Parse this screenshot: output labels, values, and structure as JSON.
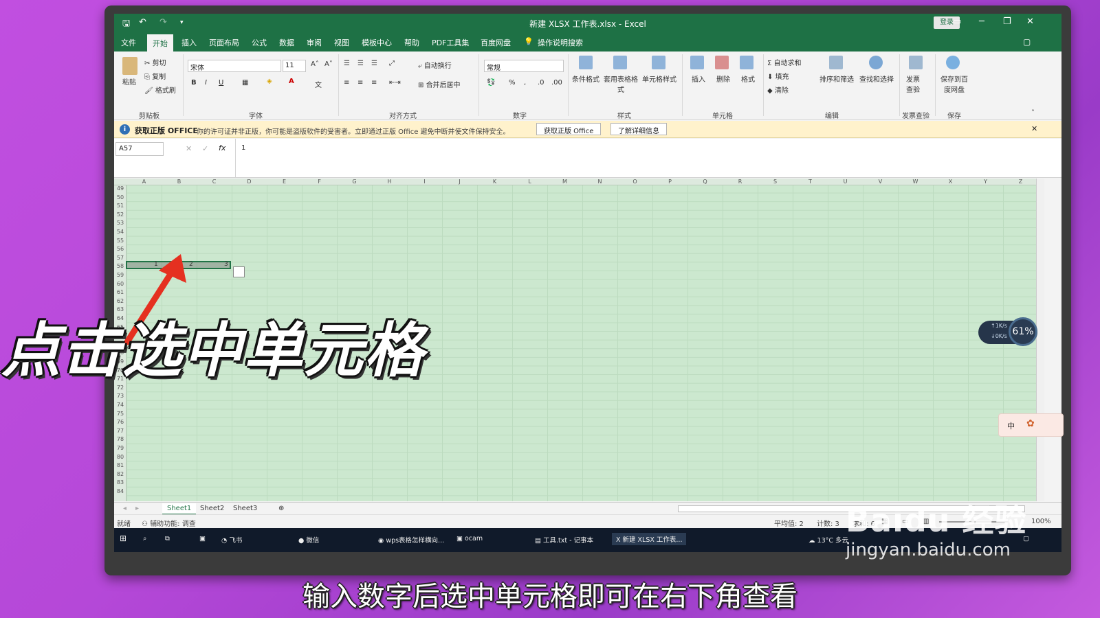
{
  "window": {
    "title": "新建 XLSX 工作表.xlsx  -  Excel",
    "login": "登录"
  },
  "menu": [
    "文件",
    "开始",
    "插入",
    "页面布局",
    "公式",
    "数据",
    "审阅",
    "视图",
    "模板中心",
    "帮助",
    "PDF工具集",
    "百度网盘",
    "操作说明搜索"
  ],
  "ribbon": {
    "clipboard": {
      "paste": "粘贴",
      "cut": "剪切",
      "copy": "复制",
      "format_painter": "格式刷",
      "label": "剪贴板"
    },
    "font": {
      "name": "宋体",
      "size": "11",
      "label": "字体"
    },
    "align": {
      "wrap": "自动换行",
      "merge": "合并后居中",
      "label": "对齐方式"
    },
    "number": {
      "format": "常规",
      "label": "数字"
    },
    "styles": {
      "cond": "条件格式",
      "table": "套用表格格式",
      "cell": "单元格样式",
      "label": "样式"
    },
    "cells": {
      "insert": "插入",
      "delete": "删除",
      "format": "格式",
      "label": "单元格"
    },
    "edit": {
      "autosum": "自动求和",
      "fill": "填充",
      "clear": "清除",
      "sort": "排序和筛选",
      "find": "查找和选择",
      "label": "编辑"
    },
    "invoice": {
      "check": "发票查验",
      "label": "发票查验"
    },
    "save": {
      "baidu": "保存到百度网盘",
      "label": "保存"
    }
  },
  "notice": {
    "title": "获取正版 OFFICE",
    "message": "你的许可证并非正版，你可能是盗版软件的受害者。立即通过正版 Office 避免中断并使文件保持安全。",
    "btn1": "获取正版 Office",
    "btn2": "了解详细信息"
  },
  "formula": {
    "namebox": "A57",
    "value": "1"
  },
  "columns": [
    "A",
    "B",
    "C",
    "D",
    "E",
    "F",
    "G",
    "H",
    "I",
    "J",
    "K",
    "L",
    "M",
    "N",
    "O",
    "P",
    "Q",
    "R",
    "S",
    "T",
    "U",
    "V",
    "W",
    "X",
    "Y",
    "Z"
  ],
  "rows": [
    "49",
    "50",
    "51",
    "52",
    "53",
    "54",
    "55",
    "56",
    "57",
    "58",
    "59",
    "60",
    "61",
    "62",
    "63",
    "64",
    "65",
    "66",
    "67",
    "68",
    "69",
    "70",
    "71",
    "72",
    "73",
    "74",
    "75",
    "76",
    "77",
    "78",
    "79",
    "80",
    "81",
    "82",
    "83",
    "84"
  ],
  "cells": {
    "a57": "1",
    "b57": "2",
    "c57": "3"
  },
  "sheets": [
    "Sheet1",
    "Sheet2",
    "Sheet3"
  ],
  "status": {
    "ready": "就绪",
    "accessibility": "辅助功能: 调查",
    "average": "平均值: 2",
    "count": "计数: 3",
    "sum": "求和: 6",
    "zoom": "100%"
  },
  "taskbar": {
    "feishu": "飞书",
    "wechat": "微信",
    "chrome": "wps表格怎样横向...",
    "ocam": "ocam",
    "notepad": "工具.txt - 记事本",
    "excel": "新建 XLSX 工作表...",
    "weather": "13°C 多云"
  },
  "overlay": {
    "caption_big": "点击选中单元格",
    "caption_sub": "输入数字后选中单元格即可在右下角查看",
    "net_percent": "61",
    "net_up": "1",
    "net_down": "0",
    "ime": "中",
    "watermark": "Baidu 经验",
    "watermark_url": "jingyan.baidu.com"
  },
  "colors": {
    "excel_green": "#1e7145",
    "grid_bg": "#cce8cf",
    "notice_bg": "#fff2cc"
  }
}
